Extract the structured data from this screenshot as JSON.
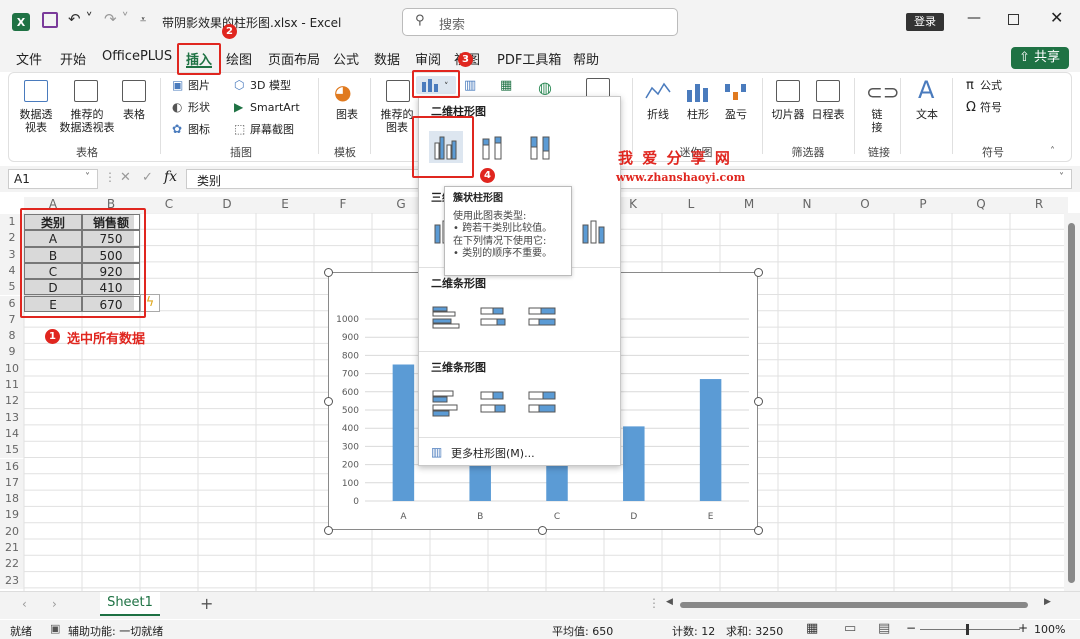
{
  "window": {
    "title": "带阴影效果的柱形图.xlsx  -  Excel",
    "search_placeholder": "搜索",
    "login": "登录"
  },
  "menu": [
    "文件",
    "开始",
    "OfficePLUS",
    "插入",
    "绘图",
    "页面布局",
    "公式",
    "数据",
    "审阅",
    "视图",
    "PDF工具箱",
    "帮助"
  ],
  "share": "共享",
  "ribbon": {
    "pivot": "数据透\n视表",
    "rec_pivot": "推荐的\n数据透视表",
    "table": "表格",
    "picture": "图片",
    "shapes": "形状",
    "icons": "图标",
    "model3d": "3D 模型",
    "smartart": "SmartArt",
    "screenshot": "屏幕截图",
    "chart_btn": "图表",
    "rec_chart": "推荐的\n图表",
    "line": "折线",
    "column": "柱形",
    "winloss": "盈亏",
    "slicer": "切片器",
    "timeline": "日程表",
    "link": "链\n接",
    "text": "文本",
    "formula": "公式",
    "symbol": "符号",
    "groups": [
      "表格",
      "插图",
      "模板",
      "迷你图",
      "筛选器",
      "链接",
      "符号"
    ]
  },
  "formula_bar": {
    "cell_ref": "A1",
    "value": "类别"
  },
  "columns": [
    "A",
    "B",
    "C",
    "D",
    "E",
    "F",
    "G",
    "H",
    "I",
    "J",
    "K",
    "L",
    "M",
    "N",
    "O",
    "P",
    "Q",
    "R"
  ],
  "rows": [
    "1",
    "2",
    "3",
    "4",
    "5",
    "6",
    "7",
    "8",
    "9",
    "10",
    "11",
    "12",
    "13",
    "14",
    "15",
    "16",
    "17",
    "18",
    "19",
    "20",
    "21",
    "22",
    "23"
  ],
  "table": {
    "headers": [
      "类别",
      "销售额"
    ],
    "data": [
      [
        "A",
        "750"
      ],
      [
        "B",
        "500"
      ],
      [
        "C",
        "920"
      ],
      [
        "D",
        "410"
      ],
      [
        "E",
        "670"
      ]
    ]
  },
  "annotations": {
    "step1": "选中所有数据",
    "badges": [
      "1",
      "2",
      "3",
      "4"
    ],
    "watermark_cn": "我 爱 分 享 网",
    "watermark_url": "www.zhanshaoyi.com"
  },
  "dropdown": {
    "sec1": "二维柱形图",
    "sec2": "三维柱形图",
    "sec3": "二维条形图",
    "sec4": "三维条形图",
    "more": "更多柱形图(M)..."
  },
  "tooltip": {
    "title": "簇状柱形图",
    "lines": [
      "使用此图表类型:",
      "• 跨若干类别比较值。",
      "在下列情况下使用它:",
      "• 类别的顺序不重要。"
    ]
  },
  "chart_data": {
    "type": "bar",
    "categories": [
      "A",
      "B",
      "C",
      "D",
      "E"
    ],
    "values": [
      750,
      500,
      920,
      410,
      670
    ],
    "ylim": [
      0,
      1000
    ],
    "yticks": [
      "0",
      "100",
      "200",
      "300",
      "400",
      "500",
      "600",
      "700",
      "800",
      "900",
      "1000"
    ],
    "bar_color": "#5b9bd5",
    "grid": true
  },
  "sheet_tab": "Sheet1",
  "status": {
    "ready": "就绪",
    "accessibility": "辅助功能: 一切就绪",
    "avg": "平均值: 650",
    "count": "计数: 12",
    "sum": "求和: 3250",
    "zoom": "100%"
  }
}
